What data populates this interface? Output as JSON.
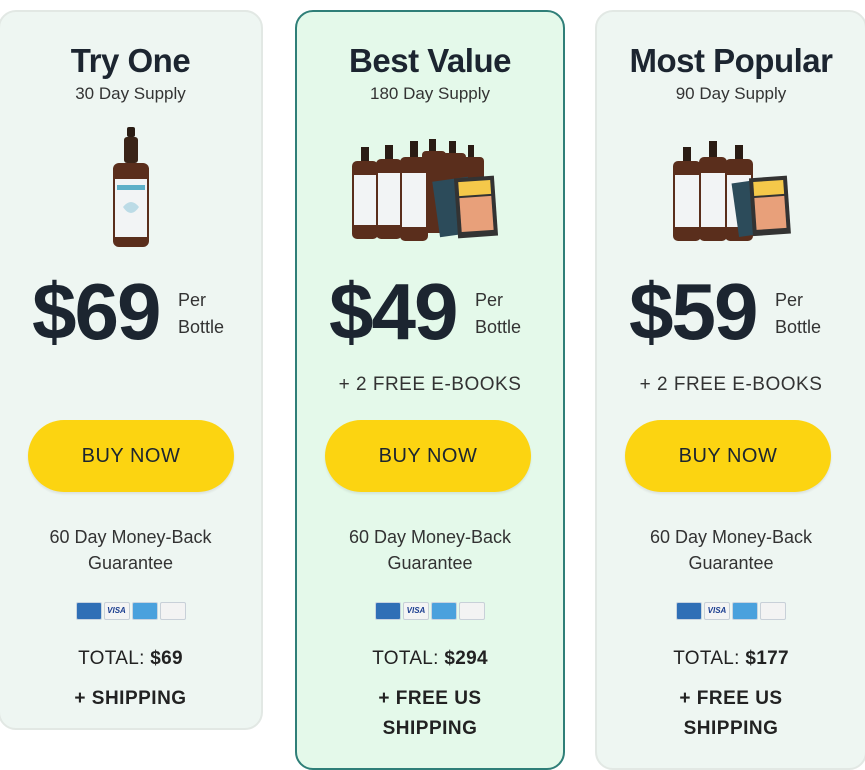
{
  "plans": [
    {
      "title": "Try One",
      "supply": "30 Day Supply",
      "price": "$69",
      "per_line1": "Per",
      "per_line2": "Bottle",
      "ebooks": "",
      "buy_label": "BUY NOW",
      "guarantee_line1": "60 Day Money-Back",
      "guarantee_line2": "Guarantee",
      "total_label": "TOTAL:",
      "total_value": "$69",
      "shipping_line1": "+ SHIPPING",
      "shipping_line2": ""
    },
    {
      "title": "Best Value",
      "supply": "180 Day Supply",
      "price": "$49",
      "per_line1": "Per",
      "per_line2": "Bottle",
      "ebooks": "+ 2 FREE E-BOOKS",
      "buy_label": "BUY NOW",
      "guarantee_line1": "60 Day Money-Back",
      "guarantee_line2": "Guarantee",
      "total_label": "TOTAL:",
      "total_value": "$294",
      "shipping_line1": "+ FREE US",
      "shipping_line2": "SHIPPING"
    },
    {
      "title": "Most Popular",
      "supply": "90 Day Supply",
      "price": "$59",
      "per_line1": "Per",
      "per_line2": "Bottle",
      "ebooks": "+ 2 FREE E-BOOKS",
      "buy_label": "BUY NOW",
      "guarantee_line1": "60 Day Money-Back",
      "guarantee_line2": "Guarantee",
      "total_label": "TOTAL:",
      "total_value": "$177",
      "shipping_line1": "+ FREE US",
      "shipping_line2": "SHIPPING"
    }
  ],
  "payment_icons": [
    "mastercard-icon",
    "visa-icon",
    "amex-icon",
    "discover-icon"
  ],
  "visa_text": "VISA",
  "colors": {
    "button": "#fcd411",
    "highlight_card_bg": "#e4f9ea",
    "highlight_card_border": "#2f7f78",
    "card_bg": "#eef6f2"
  }
}
